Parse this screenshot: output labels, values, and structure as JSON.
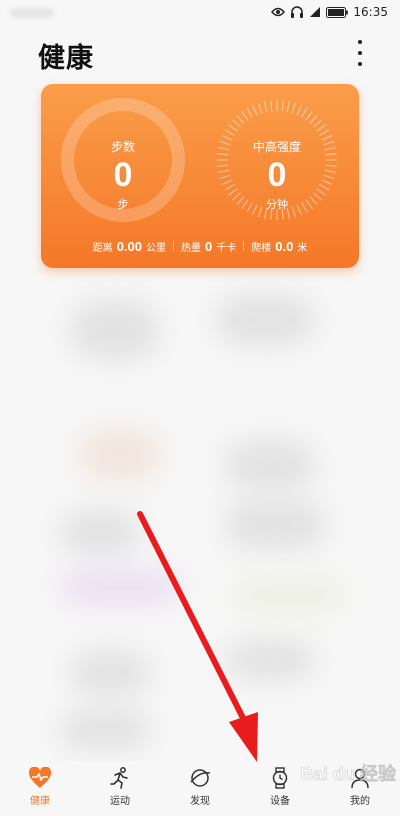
{
  "status_bar": {
    "time": "16:35"
  },
  "header": {
    "title": "健康"
  },
  "summary": {
    "steps": {
      "label": "步数",
      "value": "0",
      "unit": "步"
    },
    "intensity": {
      "label": "中高强度",
      "value": "0",
      "unit": "分钟"
    },
    "distance": {
      "label": "距离",
      "value": "0.00",
      "unit": "公里"
    },
    "calories": {
      "label": "热量",
      "value": "0",
      "unit": "千卡"
    },
    "floors": {
      "label": "爬楼",
      "value": "0.0",
      "unit": "米"
    }
  },
  "bottom_nav": {
    "items": [
      {
        "label": "健康",
        "icon": "heart-pulse-icon",
        "active": true
      },
      {
        "label": "运动",
        "icon": "running-icon"
      },
      {
        "label": "发现",
        "icon": "planet-icon"
      },
      {
        "label": "设备",
        "icon": "watch-icon"
      },
      {
        "label": "我的",
        "icon": "person-icon"
      }
    ]
  },
  "colors": {
    "accent": "#f47828",
    "card_top": "#fa9d4a",
    "annotation_arrow": "#e81c1c"
  },
  "watermark": {
    "text": "Bai du 经验"
  }
}
